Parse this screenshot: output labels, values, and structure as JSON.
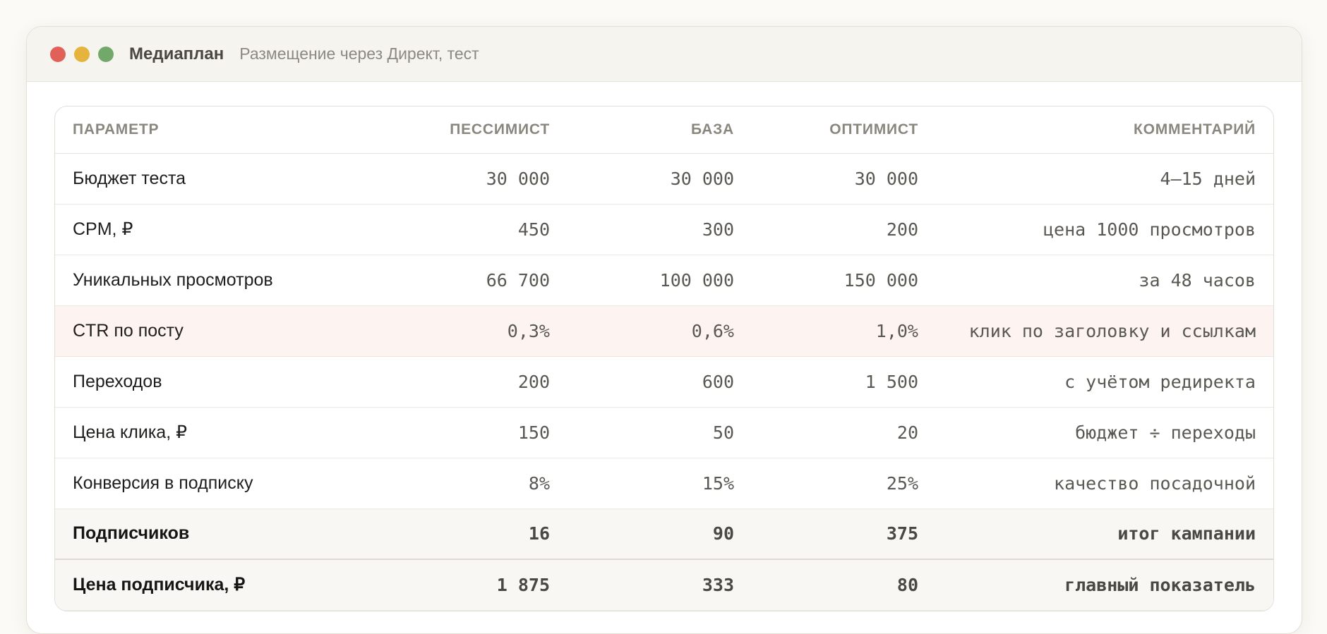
{
  "window": {
    "title": "Медиаплан",
    "subtitle": "Размещение через Директ, тест",
    "controls": [
      "close",
      "minimize",
      "maximize"
    ]
  },
  "table": {
    "headers": [
      "ПАРАМЕТР",
      "ПЕССИМИСТ",
      "БАЗА",
      "ОПТИМИСТ",
      "КОММЕНТАРИЙ"
    ],
    "rows": [
      {
        "param": "Бюджет теста",
        "pess": "30 000",
        "base": "30 000",
        "opt": "30 000",
        "comment": "4–15 дней"
      },
      {
        "param": "CPM, ₽",
        "pess": "450",
        "base": "300",
        "opt": "200",
        "comment": "цена 1000 просмотров"
      },
      {
        "param": "Уникальных просмотров",
        "pess": "66 700",
        "base": "100 000",
        "opt": "150 000",
        "comment": "за 48 часов"
      },
      {
        "param": "CTR по посту",
        "pess": "0,3%",
        "base": "0,6%",
        "opt": "1,0%",
        "comment": "клик по заголовку и ссылкам"
      },
      {
        "param": "Переходов",
        "pess": "200",
        "base": "600",
        "opt": "1 500",
        "comment": "с учётом редиректа"
      },
      {
        "param": "Цена клика, ₽",
        "pess": "150",
        "base": "50",
        "opt": "20",
        "comment": "бюджет ÷ переходы"
      },
      {
        "param": "Конверсия в подписку",
        "pess": "8%",
        "base": "15%",
        "opt": "25%",
        "comment": "качество посадочной"
      },
      {
        "param": "Подписчиков",
        "pess": "16",
        "base": "90",
        "opt": "375",
        "comment": "итог кампании"
      },
      {
        "param": "Цена подписчика, ₽",
        "pess": "1 875",
        "base": "333",
        "opt": "80",
        "comment": "главный показатель"
      }
    ]
  },
  "colors": {
    "highlight_row": "#fdf3f1",
    "close": "#e2605a",
    "minimize": "#e4b43c",
    "maximize": "#72a96a"
  }
}
